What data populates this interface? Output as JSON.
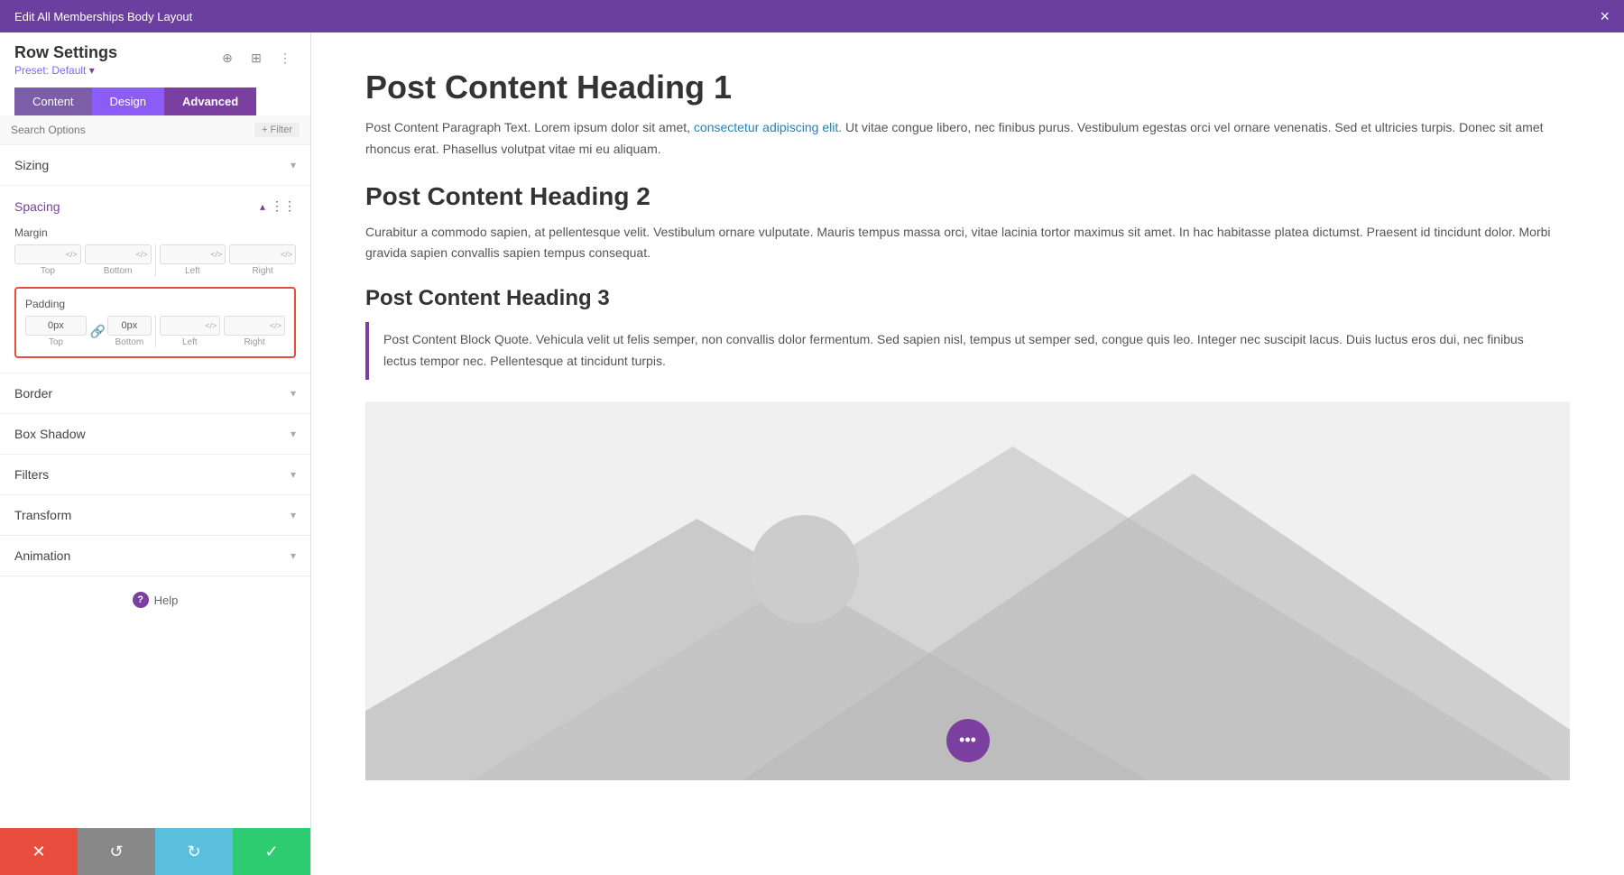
{
  "topBar": {
    "title": "Edit All Memberships Body Layout",
    "closeLabel": "×"
  },
  "sidebar": {
    "rowSettings": "Row Settings",
    "preset": "Preset: Default",
    "tabs": [
      {
        "label": "Content",
        "active": false
      },
      {
        "label": "Design",
        "active": false
      },
      {
        "label": "Advanced",
        "active": true
      }
    ],
    "search": {
      "placeholder": "Search Options",
      "filterLabel": "+ Filter"
    },
    "sections": [
      {
        "label": "Sizing",
        "expanded": false
      },
      {
        "label": "Spacing",
        "expanded": true
      },
      {
        "label": "Border",
        "expanded": false
      },
      {
        "label": "Box Shadow",
        "expanded": false
      },
      {
        "label": "Filters",
        "expanded": false
      },
      {
        "label": "Transform",
        "expanded": false
      },
      {
        "label": "Animation",
        "expanded": false
      }
    ],
    "spacing": {
      "margin": {
        "label": "Margin",
        "top": {
          "value": "",
          "placeholder": ""
        },
        "bottom": {
          "value": "",
          "placeholder": ""
        },
        "left": {
          "value": "",
          "placeholder": ""
        },
        "right": {
          "value": "",
          "placeholder": ""
        }
      },
      "padding": {
        "label": "Padding",
        "top": {
          "value": "0px"
        },
        "bottom": {
          "value": "0px"
        },
        "left": {
          "value": ""
        },
        "right": {
          "value": ""
        }
      }
    },
    "helpLabel": "Help"
  },
  "bottomBar": {
    "cancelIcon": "✕",
    "undoIcon": "↺",
    "redoIcon": "↻",
    "saveIcon": "✓"
  },
  "content": {
    "heading1": "Post Content Heading 1",
    "para1": "Post Content Paragraph Text. Lorem ipsum dolor sit amet, ",
    "para1Link": "consectetur adipiscing elit.",
    "para1Rest": " Ut vitae congue libero, nec finibus purus. Vestibulum egestas orci vel ornare venenatis. Sed et ultricies turpis. Donec sit amet rhoncus erat. Phasellus volutpat vitae mi eu aliquam.",
    "heading2": "Post Content Heading 2",
    "para2": "Curabitur a commodo sapien, at pellentesque velit. Vestibulum ornare vulputate. Mauris tempus massa orci, vitae lacinia tortor maximus sit amet. In hac habitasse platea dictumst. Praesent id tincidunt dolor. Morbi gravida sapien convallis sapien tempus consequat.",
    "heading3": "Post Content Heading 3",
    "blockquote": "Post Content Block Quote. Vehicula velit ut felis semper, non convallis dolor fermentum. Sed sapien nisl, tempus ut semper sed, congue quis leo. Integer nec suscipit lacus. Duis luctus eros dui, nec finibus lectus tempor nec. Pellentesque at tincidunt turpis.",
    "fabIcon": "•••"
  }
}
